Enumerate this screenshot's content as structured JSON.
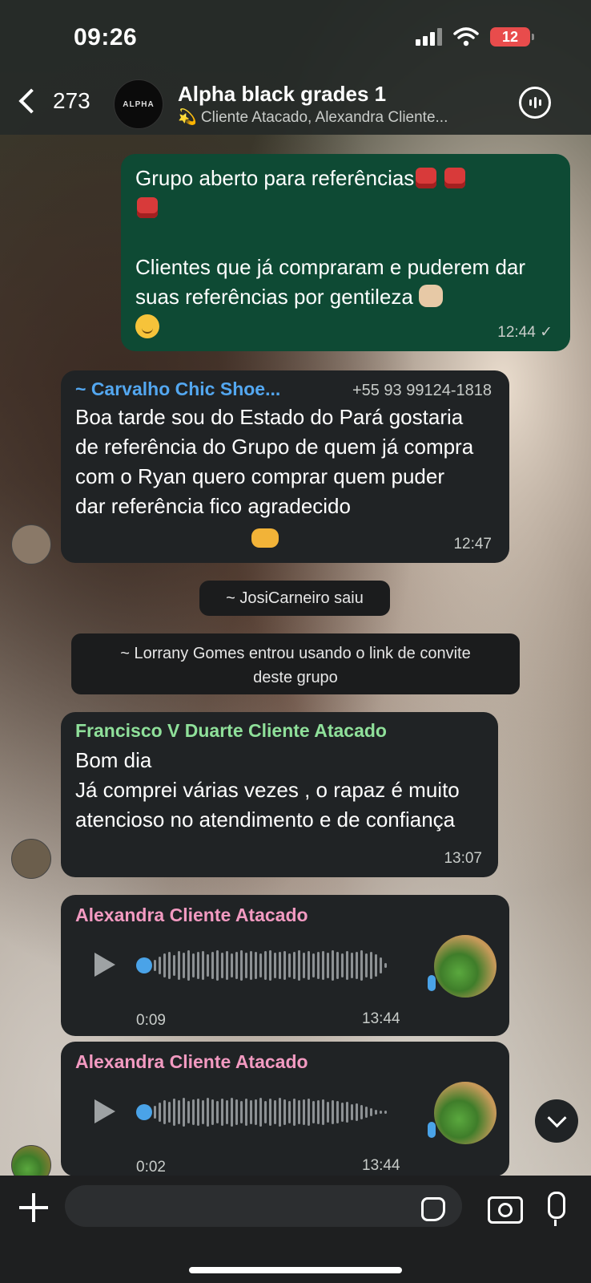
{
  "status_bar": {
    "time": "09:26",
    "battery": "12"
  },
  "header": {
    "back_count": "273",
    "avatar_text": "ALPHA",
    "title": "Alpha black grades 1",
    "subtitle": "💫 Cliente Atacado, Alexandra Cliente..."
  },
  "messages": {
    "m1": {
      "line1": "Grupo aberto para referências",
      "line2": "Clientes que já compraram e puderem dar suas referências por gentileza",
      "time": "12:44 ✓"
    },
    "m2": {
      "sender": "~ Carvalho Chic Shoe...",
      "phone": "+55 93 99124-1818",
      "text": "Boa tarde sou do Estado do Pará gostaria de referência do Grupo de quem já compra com o Ryan quero comprar quem puder dar referência fico agradecido",
      "time": "12:47"
    },
    "sys1": "~ JosiCarneiro saiu",
    "sys2": "~ Lorrany Gomes entrou usando o link de convite deste grupo",
    "m3": {
      "sender": "Francisco V Duarte Cliente Atacado",
      "line1": "Bom dia",
      "line2": "Já comprei várias vezes , o rapaz é muito atencioso no atendimento e de confiança",
      "time": "13:07"
    },
    "v1": {
      "sender": "Alexandra Cliente Atacado",
      "duration": "0:09",
      "time": "13:44"
    },
    "v2": {
      "sender": "Alexandra Cliente Atacado",
      "duration": "0:02",
      "time": "13:44"
    }
  },
  "input": {
    "placeholder": ""
  },
  "colors": {
    "outgoing_bubble": "#0e4a34",
    "incoming_bubble": "#202325",
    "sender_blue": "#53a7f0",
    "sender_green": "#8fe09a",
    "sender_pink": "#f29ac1"
  }
}
